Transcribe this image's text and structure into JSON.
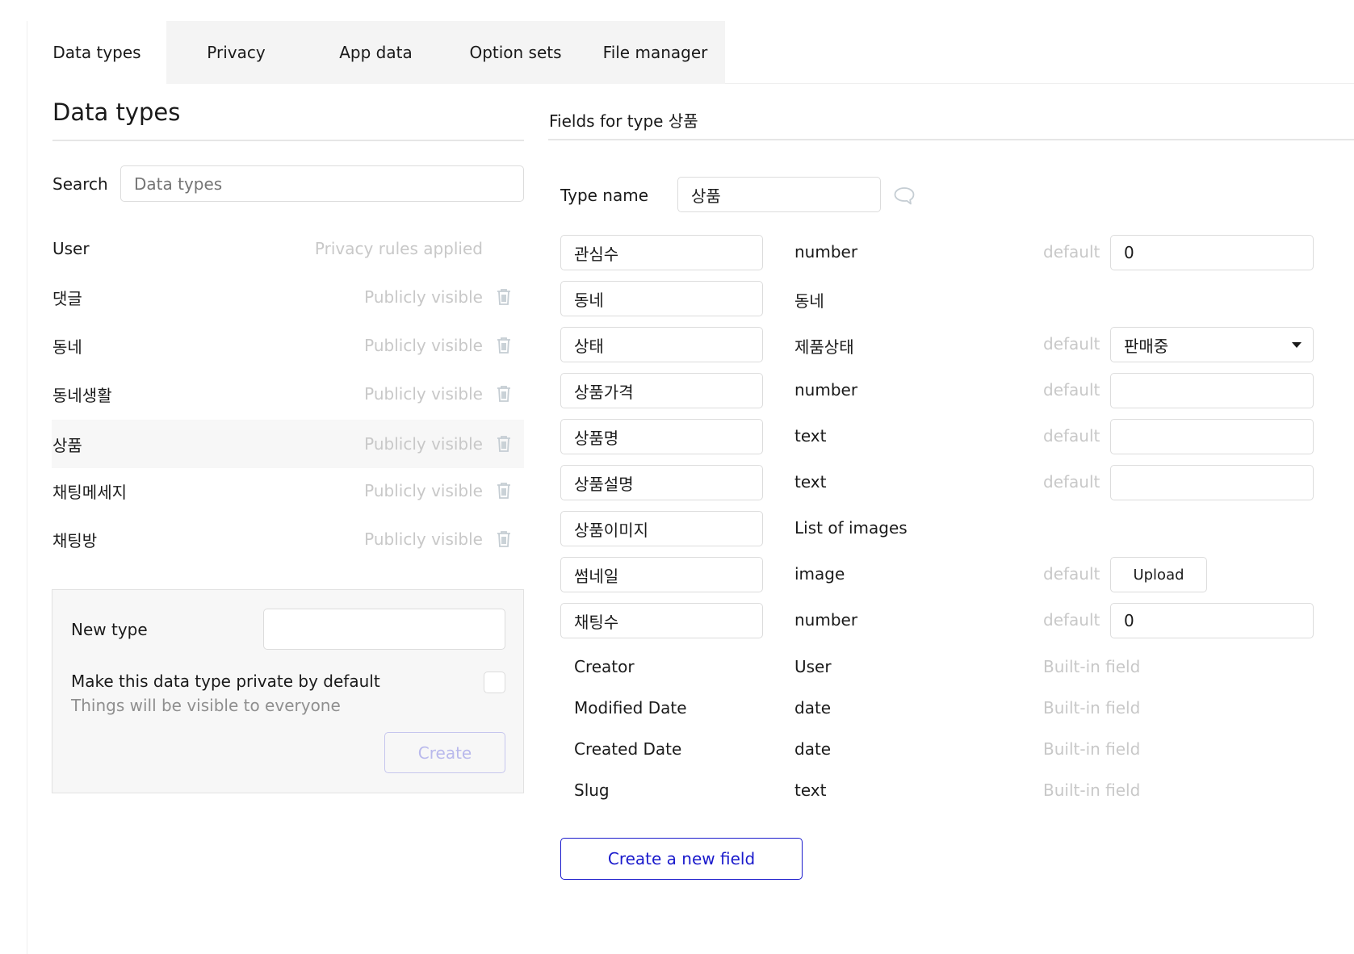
{
  "tabs": [
    {
      "label": "Data types",
      "active": true
    },
    {
      "label": "Privacy",
      "active": false
    },
    {
      "label": "App data",
      "active": false
    },
    {
      "label": "Option sets",
      "active": false
    },
    {
      "label": "File manager",
      "active": false
    }
  ],
  "left": {
    "title": "Data types",
    "search_label": "Search",
    "search_placeholder": "Data types",
    "search_value": "",
    "types": [
      {
        "name": "User",
        "status": "Privacy rules applied",
        "deletable": false,
        "selected": false
      },
      {
        "name": "댓글",
        "status": "Publicly visible",
        "deletable": true,
        "selected": false
      },
      {
        "name": "동네",
        "status": "Publicly visible",
        "deletable": true,
        "selected": false
      },
      {
        "name": "동네생활",
        "status": "Publicly visible",
        "deletable": true,
        "selected": false
      },
      {
        "name": "상품",
        "status": "Publicly visible",
        "deletable": true,
        "selected": true
      },
      {
        "name": "채팅메세지",
        "status": "Publicly visible",
        "deletable": true,
        "selected": false
      },
      {
        "name": "채팅방",
        "status": "Publicly visible",
        "deletable": true,
        "selected": false
      }
    ],
    "new_type": {
      "label": "New type",
      "value": "",
      "private_label": "Make this data type private by default",
      "private_hint": "Things will be visible to everyone",
      "private_checked": false,
      "create_label": "Create"
    }
  },
  "right": {
    "title": "Fields for type 상품",
    "type_name_label": "Type name",
    "type_name_value": "상품",
    "default_label": "default",
    "fields": [
      {
        "name": "관심수",
        "type": "number",
        "default_kind": "input",
        "default_value": "0"
      },
      {
        "name": "동네",
        "type": "동네",
        "default_kind": "none",
        "default_value": ""
      },
      {
        "name": "상태",
        "type": "제품상태",
        "default_kind": "dropdown",
        "default_value": "판매중"
      },
      {
        "name": "상품가격",
        "type": "number",
        "default_kind": "input",
        "default_value": ""
      },
      {
        "name": "상품명",
        "type": "text",
        "default_kind": "input",
        "default_value": ""
      },
      {
        "name": "상품설명",
        "type": "text",
        "default_kind": "input",
        "default_value": ""
      },
      {
        "name": "상품이미지",
        "type": "List of images",
        "default_kind": "none",
        "default_value": ""
      },
      {
        "name": "썸네일",
        "type": "image",
        "default_kind": "upload",
        "default_value": "Upload"
      },
      {
        "name": "채팅수",
        "type": "number",
        "default_kind": "input",
        "default_value": "0"
      }
    ],
    "builtin": [
      {
        "name": "Creator",
        "type": "User",
        "note": "Built-in field"
      },
      {
        "name": "Modified Date",
        "type": "date",
        "note": "Built-in field"
      },
      {
        "name": "Created Date",
        "type": "date",
        "note": "Built-in field"
      },
      {
        "name": "Slug",
        "type": "text",
        "note": "Built-in field"
      }
    ],
    "create_field_label": "Create a new field"
  },
  "icons": {
    "trash": "trash-icon",
    "comment": "comment-icon",
    "dropdown": "caret-down-icon"
  },
  "colors": {
    "accent": "#1a1acc",
    "tab_inactive_bg": "#f4f4f4",
    "muted_text": "#c8c8c8"
  }
}
